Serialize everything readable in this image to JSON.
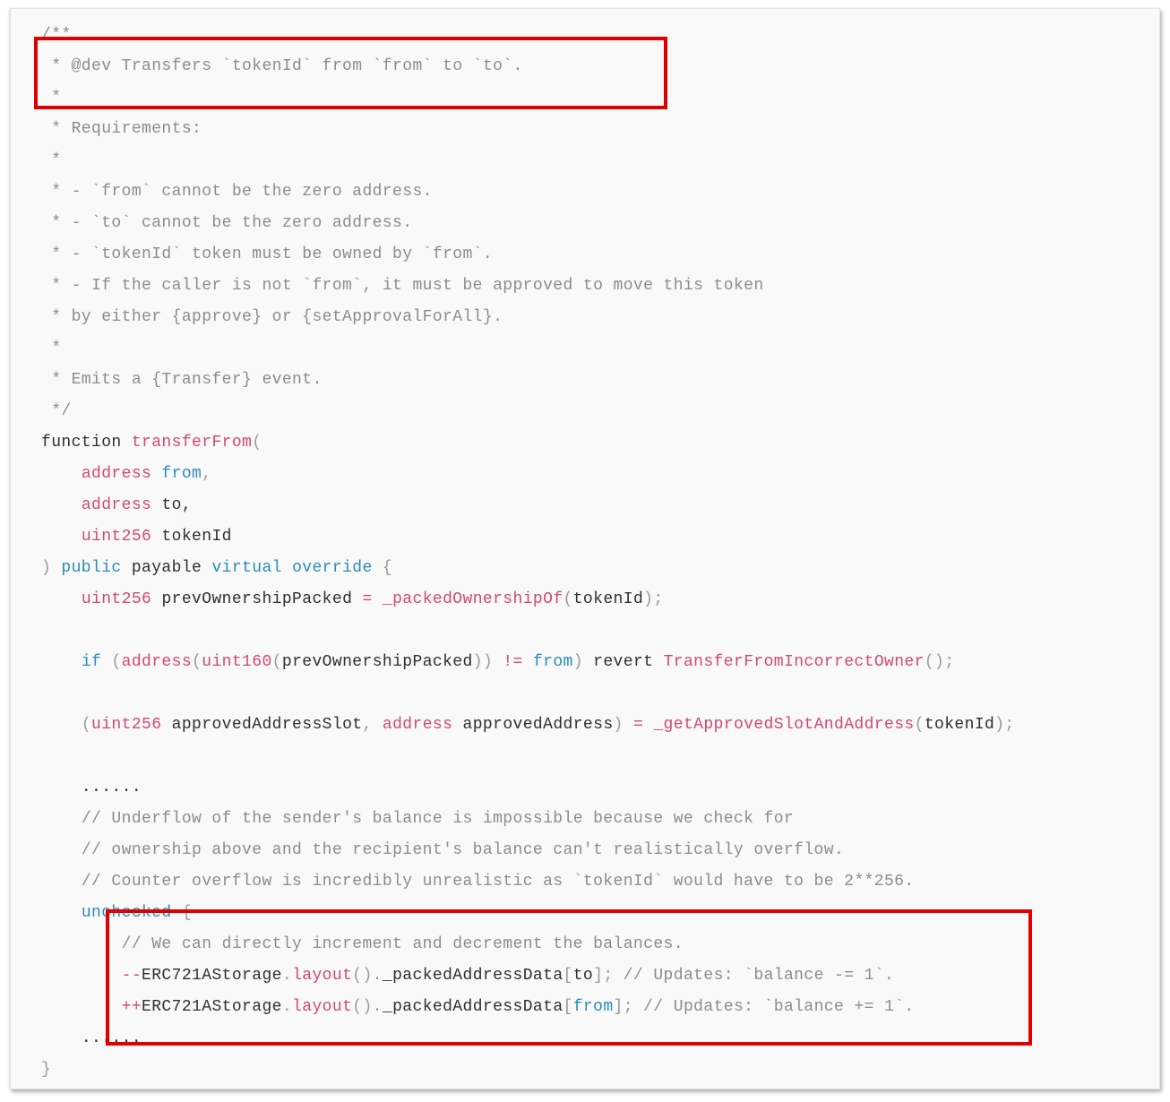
{
  "code": {
    "l01": "/**",
    "l02": " * @dev Transfers `tokenId` from `from` to `to`.",
    "l03": " *",
    "l04": " * Requirements:",
    "l05": " *",
    "l06": " * - `from` cannot be the zero address.",
    "l07": " * - `to` cannot be the zero address.",
    "l08": " * - `tokenId` token must be owned by `from`.",
    "l09": " * - If the caller is not `from`, it must be approved to move this token",
    "l10": " * by either {approve} or {setApprovalForAll}.",
    "l11": " *",
    "l12": " * Emits a {Transfer} event.",
    "l13": " */",
    "function_kw": "function",
    "function_name": "transferFrom",
    "open_paren": "(",
    "param1_type": "address",
    "param1_name": "from",
    "param2_type": "address",
    "param2_name": "to,",
    "param3_type": "uint256",
    "param3_name": "tokenId",
    "close_paren": ")",
    "mod_public": "public",
    "mod_payable": "payable",
    "mod_virtual": "virtual",
    "mod_override": "override",
    "open_brace": "{",
    "prev_type": "uint256",
    "prev_name": "prevOwnershipPacked",
    "prev_eq": "=",
    "prev_fn": "_packedOwnershipOf",
    "prev_arg": "tokenId",
    "if_kw": "if",
    "if_address": "address",
    "if_uint160": "uint160",
    "if_var": "prevOwnershipPacked",
    "if_neq": "!=",
    "if_from": "from",
    "if_revert": "revert",
    "if_error": "TransferFromIncorrectOwner",
    "ap_type1": "uint256",
    "ap_name1": "approvedAddressSlot",
    "ap_type2": "address",
    "ap_name2": "approvedAddress",
    "ap_eq": "=",
    "ap_fn": "_getApprovedSlotAndAddress",
    "ap_arg": "tokenId",
    "ellipsis1": "......",
    "comment1": "// Underflow of the sender's balance is impossible because we check for",
    "comment2": "// ownership above and the recipient's balance can't realistically overflow.",
    "comment3": "// Counter overflow is incredibly unrealistic as `tokenId` would have to be 2**256.",
    "unchecked_kw": "unchecked",
    "inner_comment": "// We can directly increment and decrement the balances.",
    "dec_op": "--",
    "dec_obj": "ERC721AStorage",
    "dec_fn": "layout",
    "dec_field": "_packedAddressData",
    "dec_idx": "to",
    "dec_comment": "// Updates: `balance -= 1`.",
    "inc_op": "++",
    "inc_obj": "ERC721AStorage",
    "inc_fn": "layout",
    "inc_field": "_packedAddressData",
    "inc_idx": "from",
    "inc_comment": "// Updates: `balance += 1`.",
    "ellipsis2": "......",
    "final_brace": "}"
  },
  "colors": {
    "keyword": "#d14a6b",
    "blue_keyword": "#2a8bb8",
    "comment": "#8c8c8c",
    "highlight_box": "#e00000"
  }
}
